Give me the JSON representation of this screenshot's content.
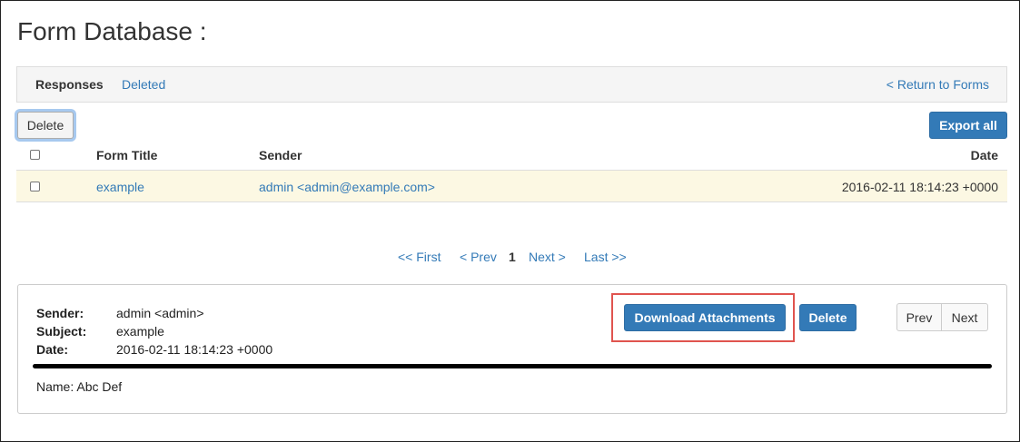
{
  "page": {
    "title": "Form Database :"
  },
  "tabs": {
    "active": "Responses",
    "other": "Deleted",
    "return_link": "< Return to Forms"
  },
  "toolbar": {
    "delete_label": "Delete",
    "export_label": "Export all"
  },
  "table": {
    "headers": {
      "title": "Form Title",
      "sender": "Sender",
      "date": "Date"
    },
    "rows": [
      {
        "title": "example",
        "sender": "admin <admin@example.com>",
        "date": "2016-02-11 18:14:23 +0000",
        "selected": false
      }
    ]
  },
  "pagination": {
    "first": "<< First",
    "prev": "< Prev",
    "current": "1",
    "next": "Next >",
    "last": "Last >>"
  },
  "detail": {
    "sender_label": "Sender:",
    "sender_value": "admin <admin>",
    "subject_label": "Subject:",
    "subject_value": "example",
    "date_label": "Date:",
    "date_value": "2016-02-11 18:14:23 +0000",
    "download_label": "Download Attachments",
    "delete_label": "Delete",
    "prev_label": "Prev",
    "next_label": "Next",
    "field_text": "Name: Abc Def"
  },
  "colors": {
    "accent": "#337ab7",
    "row_highlight": "#fcf8e3",
    "callout": "#e0544f"
  }
}
